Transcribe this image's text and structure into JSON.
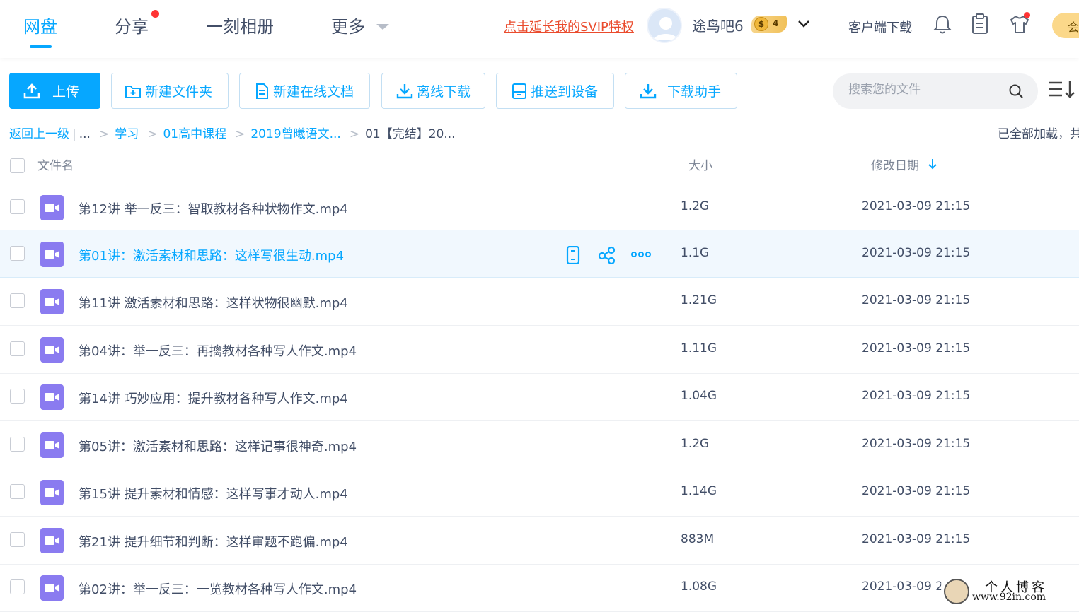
{
  "nav": {
    "tabs": [
      "网盘",
      "分享",
      "一刻相册",
      "更多"
    ],
    "svip_link": "点击延长我的SVIP特权",
    "username": "途鸟吧6",
    "vip_coin": "$",
    "vip_level": "4",
    "client_download": "客户端下载",
    "member_label": "会"
  },
  "toolbar": {
    "upload": "上传",
    "new_folder": "新建文件夹",
    "new_doc": "新建在线文档",
    "offline_download": "离线下载",
    "push_device": "推送到设备",
    "download_helper": "下载助手",
    "search_placeholder": "搜索您的文件"
  },
  "breadcrumb": {
    "back": "返回上一级",
    "ellipsis": "...",
    "items": [
      "学习",
      "01高中课程",
      "2019曾曦语文..."
    ],
    "current": "01【完结】20...",
    "status": "已全部加载，共"
  },
  "table": {
    "headers": {
      "name": "文件名",
      "size": "大小",
      "date": "修改日期"
    },
    "rows": [
      {
        "name": "第12讲 举一反三：智取教材各种状物作文.mp4",
        "size": "1.2G",
        "date": "2021-03-09 21:15"
      },
      {
        "name": "第01讲：激活素材和思路：这样写很生动.mp4",
        "size": "1.1G",
        "date": "2021-03-09 21:15"
      },
      {
        "name": "第11讲 激活素材和思路：这样状物很幽默.mp4",
        "size": "1.21G",
        "date": "2021-03-09 21:15"
      },
      {
        "name": "第04讲：举一反三：再擒教材各种写人作文.mp4",
        "size": "1.11G",
        "date": "2021-03-09 21:15"
      },
      {
        "name": "第14讲 巧妙应用：提升教材各种写人作文.mp4",
        "size": "1.04G",
        "date": "2021-03-09 21:15"
      },
      {
        "name": "第05讲：激活素材和思路：这样记事很神奇.mp4",
        "size": "1.2G",
        "date": "2021-03-09 21:15"
      },
      {
        "name": "第15讲 提升素材和情感：这样写事才动人.mp4",
        "size": "1.14G",
        "date": "2021-03-09 21:15"
      },
      {
        "name": "第21讲 提升细节和判断：这样审题不跑偏.mp4",
        "size": "883M",
        "date": "2021-03-09 21:15"
      },
      {
        "name": "第02讲：举一反三：一览教材各种写人作文.mp4",
        "size": "1.08G",
        "date": "2021-03-09 2"
      }
    ]
  },
  "watermark": {
    "title": "个人博客",
    "url": "www.92in.com"
  },
  "colors": {
    "accent": "#06a7ff",
    "svip_red": "#ea4b2d",
    "video_icon": "#8a7bf0",
    "hover_row": "#f1f8fe"
  }
}
